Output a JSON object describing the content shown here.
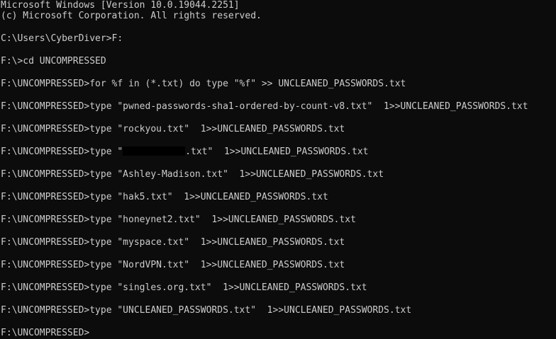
{
  "terminal": {
    "background_color": "#0c0c0c",
    "text_color": "#cccccc",
    "banner": [
      "Microsoft Windows [Version 10.0.19044.2251]",
      "(c) Microsoft Corporation. All rights reserved."
    ],
    "lines": [
      "C:\\Users\\CyberDiver>F:",
      "F:\\>cd UNCOMPRESSED",
      "F:\\UNCOMPRESSED>for %f in (*.txt) do type \"%f\" >> UNCLEANED_PASSWORDS.txt",
      "F:\\UNCOMPRESSED>type \"pwned-passwords-sha1-ordered-by-count-v8.txt\"  1>>UNCLEANED_PASSWORDS.txt",
      "F:\\UNCOMPRESSED>type \"rockyou.txt\"  1>>UNCLEANED_PASSWORDS.txt",
      {
        "prefix": "F:\\UNCOMPRESSED>type \"",
        "suffix": ".txt\"  1>>UNCLEANED_PASSWORDS.txt"
      },
      "F:\\UNCOMPRESSED>type \"Ashley-Madison.txt\"  1>>UNCLEANED_PASSWORDS.txt",
      "F:\\UNCOMPRESSED>type \"hak5.txt\"  1>>UNCLEANED_PASSWORDS.txt",
      "F:\\UNCOMPRESSED>type \"honeynet2.txt\"  1>>UNCLEANED_PASSWORDS.txt",
      "F:\\UNCOMPRESSED>type \"myspace.txt\"  1>>UNCLEANED_PASSWORDS.txt",
      "F:\\UNCOMPRESSED>type \"NordVPN.txt\"  1>>UNCLEANED_PASSWORDS.txt",
      "F:\\UNCOMPRESSED>type \"singles.org.txt\"  1>>UNCLEANED_PASSWORDS.txt",
      "F:\\UNCOMPRESSED>type \"UNCLEANED_PASSWORDS.txt\"  1>>UNCLEANED_PASSWORDS.txt",
      "F:\\UNCOMPRESSED>"
    ]
  }
}
